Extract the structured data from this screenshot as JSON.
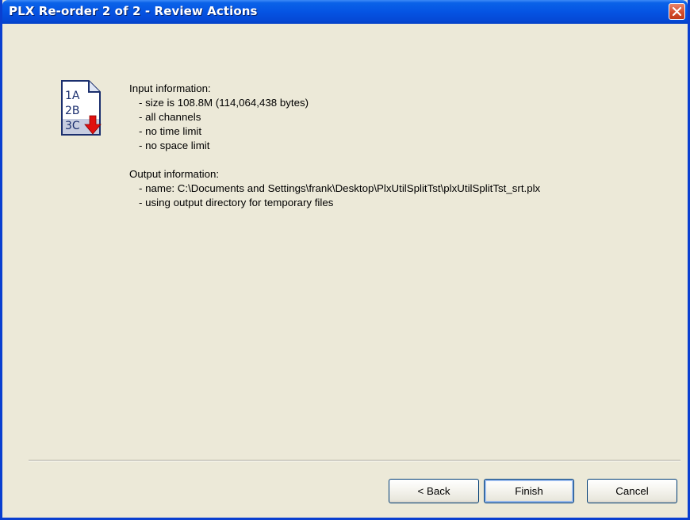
{
  "window": {
    "title": "PLX Re-order 2 of 2 - Review Actions"
  },
  "icon": {
    "name": "reorder-document-icon",
    "lines": [
      "1A",
      "2B",
      "3C"
    ]
  },
  "input_info": {
    "heading": "Input information:",
    "items": [
      "- size is 108.8M (114,064,438 bytes)",
      "- all channels",
      "- no time limit",
      "- no space limit"
    ]
  },
  "output_info": {
    "heading": "Output information:",
    "items": [
      "- name: C:\\Documents and Settings\\frank\\Desktop\\PlxUtilSplitTst\\plxUtilSplitTst_srt.plx",
      "- using output directory for temporary files"
    ]
  },
  "buttons": {
    "back": "< Back",
    "finish": "Finish",
    "cancel": "Cancel"
  },
  "colors": {
    "titlebar": "#0554e3",
    "dialog_bg": "#ece9d8",
    "close_button": "#d54d2c",
    "arrow": "#e01010"
  }
}
